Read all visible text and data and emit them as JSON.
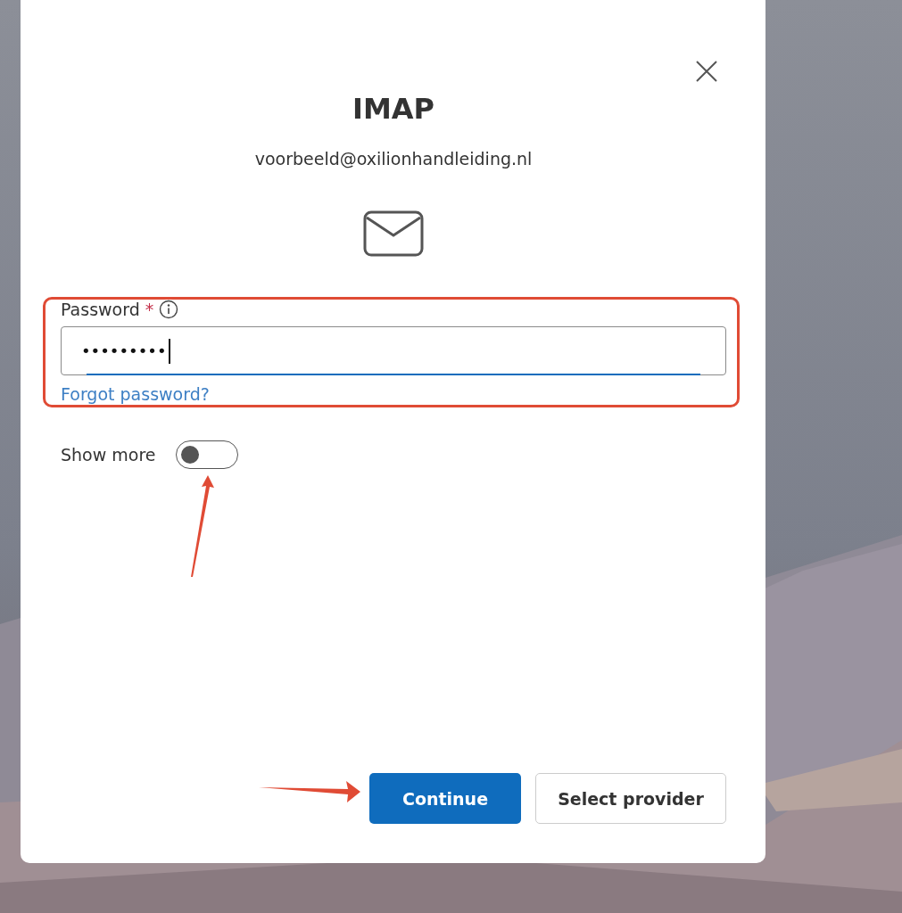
{
  "dialog": {
    "title": "IMAP",
    "email": "voorbeeld@oxilionhandleiding.nl",
    "password": {
      "label": "Password",
      "required_mark": "*",
      "value": "•••••••••",
      "focused": true
    },
    "forgot_link": "Forgot password?",
    "show_more": {
      "label": "Show more",
      "on": false
    },
    "buttons": [
      {
        "label": "Continue",
        "kind": "primary"
      },
      {
        "label": "Select provider",
        "kind": "secondary"
      }
    ]
  }
}
